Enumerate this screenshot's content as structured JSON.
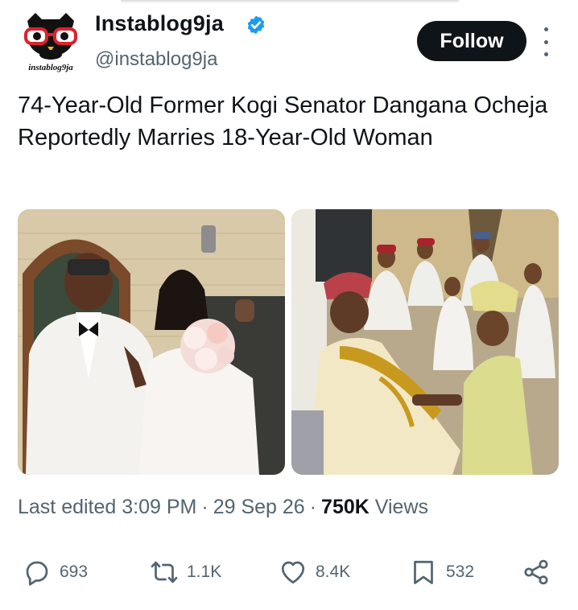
{
  "account": {
    "display_name": "Instablog9ja",
    "handle": "@instablog9ja",
    "avatar_text": "instablog9ja",
    "verified": true
  },
  "follow_label": "Follow",
  "tweet_text": "74-Year-Old Former Kogi Senator Dangana Ocheja Reportedly Marries 18-Year-Old Woman",
  "meta": {
    "prefix": "Last edited",
    "time": "3:09 PM",
    "date": "29 Sep 26",
    "views_count": "750K",
    "views_label": "Views"
  },
  "actions": {
    "replies": "693",
    "reposts": "1.1K",
    "likes": "8.4K",
    "bookmarks": "532"
  },
  "colors": {
    "accent": "#1d9bf0",
    "text": "#0f1419",
    "muted": "#536471"
  }
}
